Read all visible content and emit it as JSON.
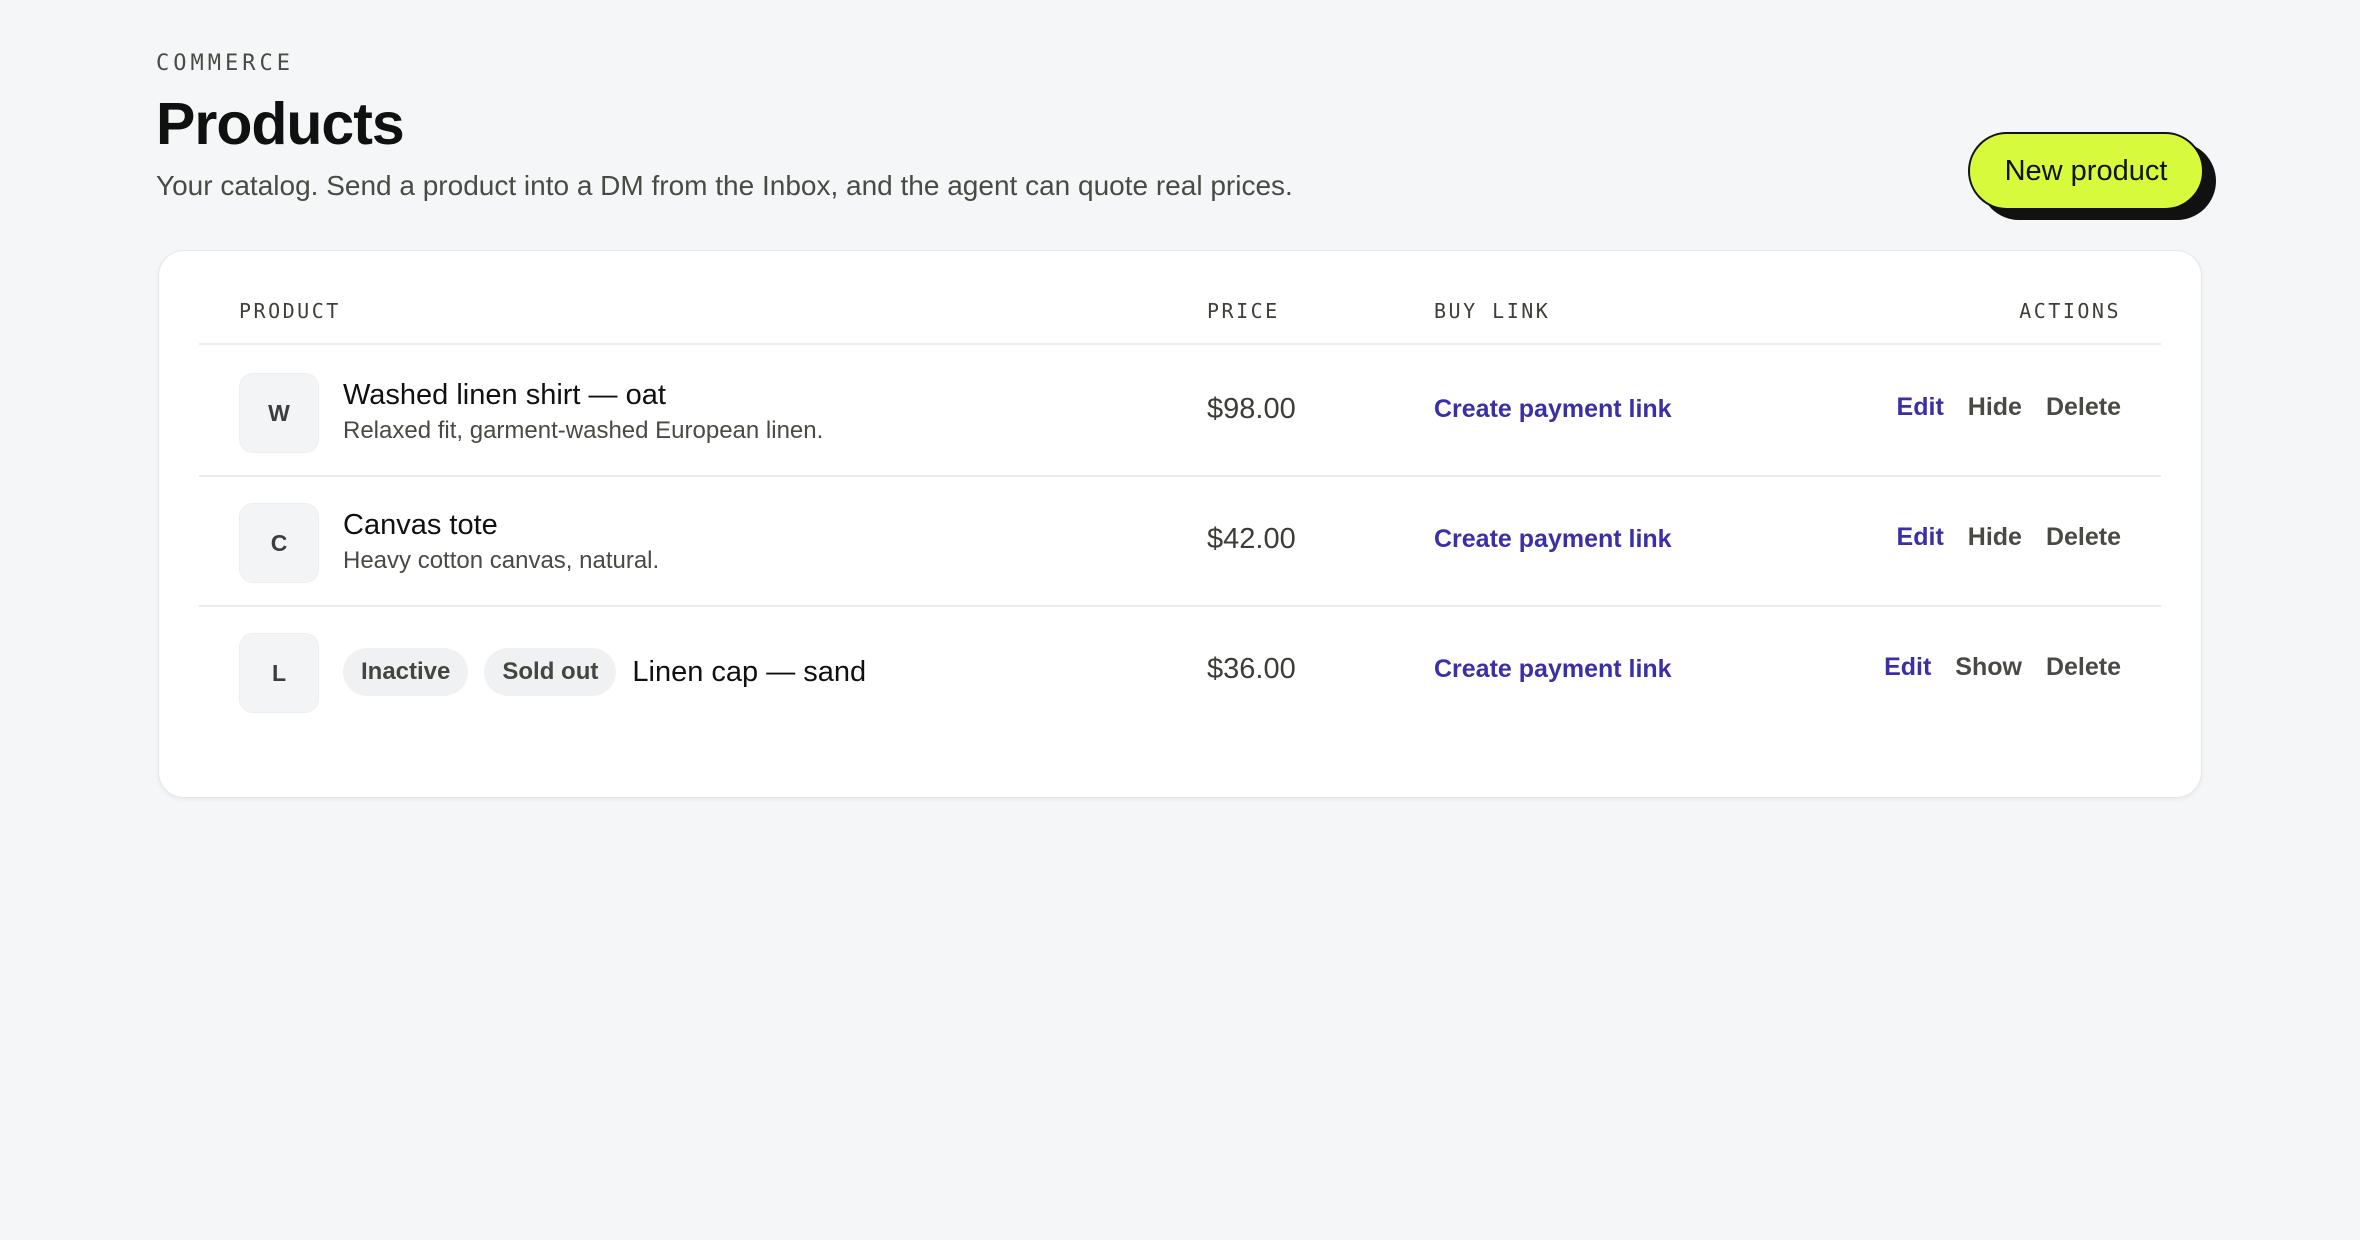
{
  "header": {
    "eyebrow": "COMMERCE",
    "title": "Products",
    "subtitle": "Your catalog. Send a product into a DM from the Inbox, and the agent can quote real prices.",
    "new_button_label": "New product"
  },
  "colors": {
    "accent_button": "#d8fa3c",
    "link": "#3a2fa6",
    "background": "#f5f6f7"
  },
  "table": {
    "columns": {
      "product": "PRODUCT",
      "price": "PRICE",
      "buy_link": "BUY LINK",
      "actions": "ACTIONS"
    },
    "rows": [
      {
        "initial": "W",
        "name": "Washed linen shirt — oat",
        "description": "Relaxed fit, garment-washed European linen.",
        "price": "$98.00",
        "buy_link": "Create payment link",
        "edit": "Edit",
        "toggle": "Hide",
        "delete": "Delete"
      },
      {
        "initial": "C",
        "name": "Canvas tote",
        "description": "Heavy cotton canvas, natural.",
        "price": "$42.00",
        "buy_link": "Create payment link",
        "edit": "Edit",
        "toggle": "Hide",
        "delete": "Delete"
      },
      {
        "initial": "L",
        "badges": [
          "Inactive",
          "Sold out"
        ],
        "name": "Linen cap — sand",
        "price": "$36.00",
        "buy_link": "Create payment link",
        "edit": "Edit",
        "toggle": "Show",
        "delete": "Delete"
      }
    ]
  }
}
